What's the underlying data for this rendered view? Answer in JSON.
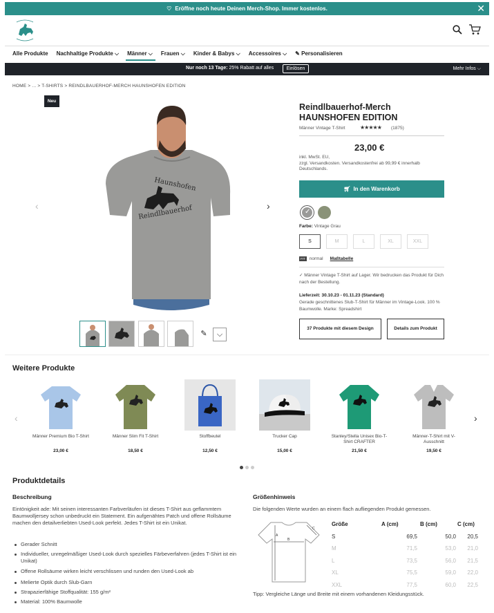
{
  "promo": {
    "text": "Eröffne noch heute Deinen Merch-Shop. Immer kostenlos."
  },
  "header": {
    "logo_alt": "Reindlbauerhof logo"
  },
  "nav": {
    "items": [
      "Alle Produkte",
      "Nachhaltige Produkte",
      "Männer",
      "Frauen",
      "Kinder & Babys",
      "Accessoires",
      "Personalisieren"
    ]
  },
  "offer_bar": {
    "prefix": "Nur noch 13 Tage:",
    "text": "25% Rabatt auf alles",
    "button": "Einlösen",
    "more": "Mehr Infos"
  },
  "breadcrumb": "HOME > ... > T-SHIRTS > REINDLBAUERHOF-MERCH HAUNSHOFEN EDITION",
  "badge": "Neu",
  "print_text": {
    "top": "Haunshofen",
    "bottom": "Reindlbauerhof"
  },
  "product": {
    "title_line1": "Reindlbauerhof-Merch",
    "title_line2": "HAUNSHOFEN EDITION",
    "subtitle": "Männer Vintage T-Shirt",
    "rating_count": "(1875)",
    "price": "23,00 €",
    "tax_line1": "inkl. MwSt. EU,",
    "tax_line2": "zzgl. Versandkosten. Versandkostenfrei ab 99,99 € innerhalb Deutschlands.",
    "cart_button": "In den Warenkorb",
    "color_label": "Farbe:",
    "color_value": "Vintage Grau",
    "sizes": [
      "S",
      "M",
      "L",
      "XL",
      "XXL"
    ],
    "fit_tag": "FIT",
    "fit_label": "normal",
    "size_chart": "Maßtabelle",
    "stock_note": "✓ Männer Vintage T-Shirt auf Lager. Wir bedrucken das Produkt für Dich nach der Bestellung.",
    "delivery_label": "Lieferzeit: 30.10.23 - 01.11.23 (Standard)",
    "delivery_desc": "Gerade geschnittenes Slub-T-Shirt für Männer im Vintage-Look. 100 % Baumwolle. Marke: Spreadshirt",
    "btn_design": "37 Produkte mit diesem Design",
    "btn_details": "Details zum Produkt"
  },
  "more": {
    "title": "Weitere Produkte",
    "items": [
      {
        "name": "Männer Premium Bio T-Shirt",
        "price": "23,00 €"
      },
      {
        "name": "Männer Slim Fit T-Shirt",
        "price": "18,50 €"
      },
      {
        "name": "Stoffbeutel",
        "price": "12,50 €"
      },
      {
        "name": "Trucker Cap",
        "price": "15,00 €"
      },
      {
        "name": "Stanley/Stella Unisex Bio-T-Shirt CRAFTER",
        "price": "21,50 €"
      },
      {
        "name": "Männer-T-Shirt mit V-Ausschnitt",
        "price": "19,50 €"
      }
    ]
  },
  "details": {
    "title": "Produktdetails",
    "desc_title": "Beschreibung",
    "desc": "Eintönigkeit ade: Mit seinen interessanten Farbverläufen ist dieses T-Shirt aus geflammtem Baumwolljersey schon unbedruckt ein Statement. Ein aufgenähtes Patch und offene Rollsäume machen den detailverliebten Used-Look perfekt. Jedes T-Shirt ist ein Unikat.",
    "bullets": [
      "Gerader Schnitt",
      "Individueller, unregelmäßiger Used-Look durch spezielles Färbeverfahren (jedes T-Shirt ist ein Unikat)",
      "Offene Rollsäume wirken leicht verschlissen und runden den Used-Look ab",
      "Melierte Optik durch Slub-Garn",
      "Strapazierfähige Stoffqualität: 155 g/m²",
      "Material: 100% Baumwolle"
    ],
    "size_title": "Größenhinweis",
    "size_desc": "Die folgenden Werte wurden an einem flach aufliegenden Produkt gemessen.",
    "size_headers": [
      "Größe",
      "A (cm)",
      "B (cm)",
      "C (cm)"
    ],
    "size_rows": [
      [
        "S",
        "69,5",
        "50,0",
        "20,5"
      ],
      [
        "M",
        "71,5",
        "53,0",
        "21,0"
      ],
      [
        "L",
        "73,5",
        "56,0",
        "21,5"
      ],
      [
        "XL",
        "75,5",
        "59,0",
        "22,0"
      ],
      [
        "XXL",
        "77,5",
        "60,0",
        "22,5"
      ]
    ],
    "tip": "Tipp: Vergleiche Länge und Breite mit einem vorhandenen Kleidungsstück."
  },
  "colors": {
    "accent": "#2b8f8a",
    "dark": "#1f2329"
  }
}
